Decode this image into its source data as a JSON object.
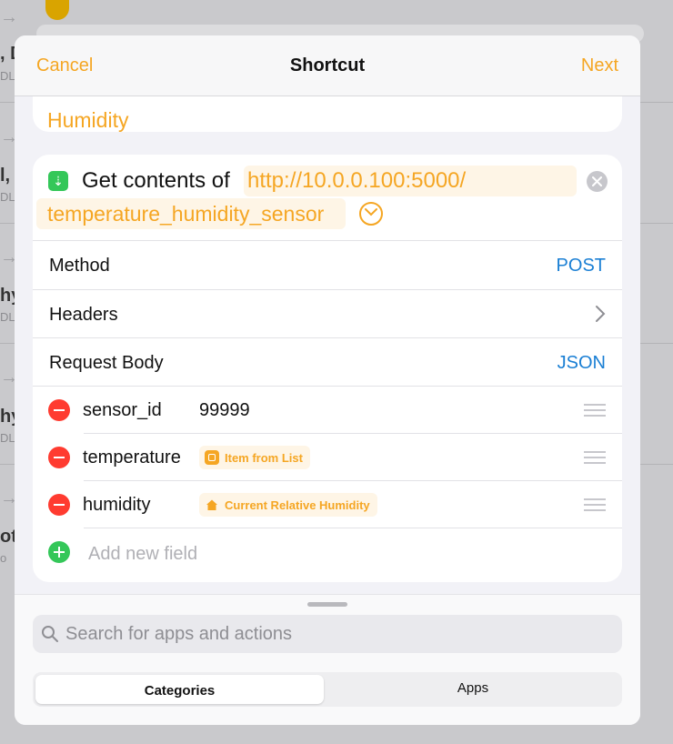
{
  "background": {
    "rows": [
      {
        "title": ", D",
        "sub": "DL"
      },
      {
        "title": "l, I",
        "sub": "DL"
      },
      {
        "title": "hy",
        "sub": "DL"
      },
      {
        "title": "hy",
        "sub": "DL"
      },
      {
        "title": "ot",
        "sub": "o"
      }
    ]
  },
  "nav": {
    "cancel": "Cancel",
    "title": "Shortcut",
    "next": "Next"
  },
  "previous_action": {
    "token": "Humidity"
  },
  "action": {
    "title": "Get contents of",
    "url_line1": "http://10.0.0.100:5000/",
    "url_line2": "temperature_humidity_sensor",
    "method_label": "Method",
    "method_value": "POST",
    "headers_label": "Headers",
    "body_label": "Request Body",
    "body_value": "JSON",
    "fields": [
      {
        "key": "sensor_id",
        "value": "99999"
      },
      {
        "key": "temperature",
        "variable": "Item from List",
        "variable_icon": "list-icon"
      },
      {
        "key": "humidity",
        "variable": "Current Relative Humidity",
        "variable_icon": "home-icon"
      }
    ],
    "add_field": "Add new field"
  },
  "panel": {
    "search_placeholder": "Search for apps and actions",
    "segments": [
      "Categories",
      "Apps"
    ],
    "selected_segment": "Categories"
  },
  "colors": {
    "accent": "#f5a623",
    "link": "#1a7fd4",
    "delete": "#ff3b30",
    "add": "#34c759"
  }
}
